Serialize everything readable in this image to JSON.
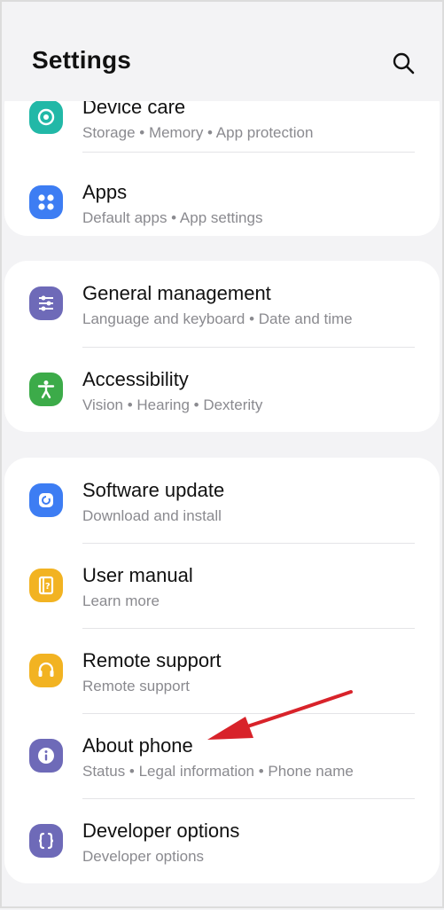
{
  "header": {
    "title": "Settings",
    "search_icon": "search-icon"
  },
  "groups": [
    {
      "items": [
        {
          "label": "Device care",
          "subtitle": "Storage  •  Memory  •  App protection",
          "icon": "device-care-icon",
          "color": "#22b8a7"
        },
        {
          "label": "Apps",
          "subtitle": "Default apps  •  App settings",
          "icon": "apps-icon",
          "color": "#3d7df3"
        }
      ]
    },
    {
      "items": [
        {
          "label": "General management",
          "subtitle": "Language and keyboard  •  Date and time",
          "icon": "sliders-icon",
          "color": "#6e6ab8"
        },
        {
          "label": "Accessibility",
          "subtitle": "Vision  •  Hearing  •  Dexterity",
          "icon": "accessibility-icon",
          "color": "#3cab49"
        }
      ]
    },
    {
      "items": [
        {
          "label": "Software update",
          "subtitle": "Download and install",
          "icon": "software-update-icon",
          "color": "#3d7df3"
        },
        {
          "label": "User manual",
          "subtitle": "Learn more",
          "icon": "user-manual-icon",
          "color": "#f2b322"
        },
        {
          "label": "Remote support",
          "subtitle": "Remote support",
          "icon": "headset-icon",
          "color": "#f2b322"
        },
        {
          "label": "About phone",
          "subtitle": "Status  •  Legal information  •  Phone name",
          "icon": "info-icon",
          "color": "#6e6ab8"
        },
        {
          "label": "Developer options",
          "subtitle": "Developer options",
          "icon": "braces-icon",
          "color": "#6e6ab8"
        }
      ]
    }
  ],
  "annotation": {
    "type": "arrow",
    "color": "#d8232a",
    "points_to": "About phone"
  }
}
